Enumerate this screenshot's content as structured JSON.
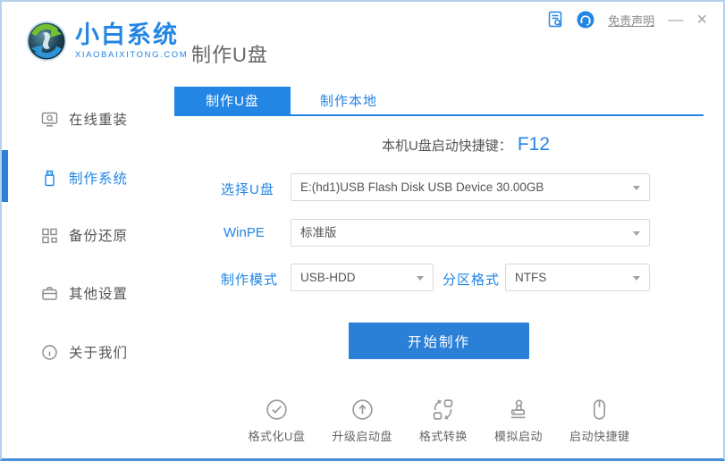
{
  "brand": {
    "name": "小白系统",
    "domain": "XIAOBAIXITONG.COM",
    "logo_icon": "sync-sphere-logo"
  },
  "page_title": "制作U盘",
  "titlebar": {
    "doc_icon": "document-search-icon",
    "support_icon": "headset-icon",
    "disclaimer_link": "免责声明",
    "minimize_label": "—",
    "close_label": "×"
  },
  "sidebar": {
    "items": [
      {
        "label": "在线重装",
        "icon": "monitor-icon",
        "active": false
      },
      {
        "label": "制作系统",
        "icon": "usb-drive-icon",
        "active": true
      },
      {
        "label": "备份还原",
        "icon": "grid-squares-icon",
        "active": false
      },
      {
        "label": "其他设置",
        "icon": "briefcase-icon",
        "active": false
      },
      {
        "label": "关于我们",
        "icon": "info-circle-icon",
        "active": false
      }
    ]
  },
  "tabs": [
    {
      "label": "制作U盘",
      "active": true
    },
    {
      "label": "制作本地",
      "active": false
    }
  ],
  "main": {
    "hotkey_label": "本机U盘启动快捷键：",
    "hotkey_value": "F12",
    "usb_label": "选择U盘",
    "usb_value": "E:(hd1)USB Flash Disk USB Device 30.00GB",
    "winpe_label": "WinPE",
    "winpe_value": "标准版",
    "mode_label": "制作模式",
    "mode_value": "USB-HDD",
    "partition_label": "分区格式",
    "partition_value": "NTFS",
    "start_button": "开始制作"
  },
  "footer_tools": [
    {
      "label": "格式化U盘",
      "icon": "check-circle-icon"
    },
    {
      "label": "升级启动盘",
      "icon": "arrow-up-circle-icon"
    },
    {
      "label": "格式转换",
      "icon": "convert-swap-icon"
    },
    {
      "label": "模拟启动",
      "icon": "stamp-icon"
    },
    {
      "label": "启动快捷键",
      "icon": "mouse-icon"
    }
  ],
  "colors": {
    "accent_blue": "#2385e4",
    "button_blue": "#2a7fd6",
    "window_border": "#b3d0ec",
    "window_border_bottom": "#4a90d9",
    "text_gray": "#666666",
    "icon_gray": "#999999"
  }
}
